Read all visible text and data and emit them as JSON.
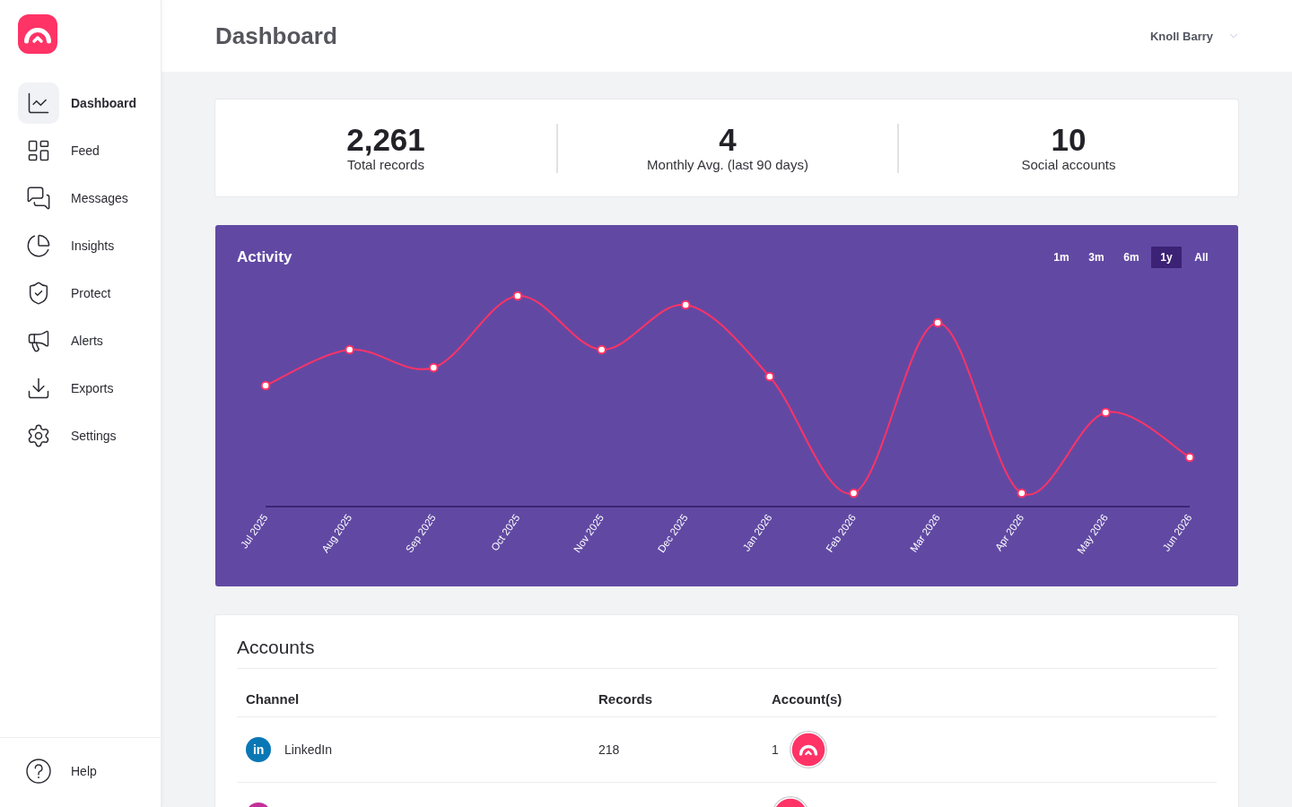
{
  "sidebar": {
    "items": [
      {
        "label": "Dashboard",
        "selected": true
      },
      {
        "label": "Feed",
        "selected": false
      },
      {
        "label": "Messages",
        "selected": false
      },
      {
        "label": "Insights",
        "selected": false
      },
      {
        "label": "Protect",
        "selected": false
      },
      {
        "label": "Alerts",
        "selected": false
      },
      {
        "label": "Exports",
        "selected": false
      },
      {
        "label": "Settings",
        "selected": false
      }
    ],
    "footer_items": [
      {
        "label": "Help",
        "selected": false
      }
    ]
  },
  "header": {
    "title": "Dashboard",
    "user": "Knoll Barry"
  },
  "stats": [
    {
      "value": "2,261",
      "label": "Total records"
    },
    {
      "value": "4",
      "label": "Monthly Avg. (last 90 days)"
    },
    {
      "value": "10",
      "label": "Social accounts"
    }
  ],
  "activity": {
    "title": "Activity",
    "ranges": [
      {
        "label": "1m",
        "selected": false
      },
      {
        "label": "3m",
        "selected": false
      },
      {
        "label": "6m",
        "selected": false
      },
      {
        "label": "1y",
        "selected": true
      },
      {
        "label": "All",
        "selected": false
      }
    ],
    "month_labels": [
      "Jul 2025",
      "Aug 2025",
      "Sep 2025",
      "Oct 2025",
      "Nov 2025",
      "Dec 2025",
      "Jan 2026",
      "Feb 2026",
      "Mar 2026",
      "Apr 2026",
      "May 2026",
      "Jun 2026"
    ]
  },
  "accounts": {
    "title": "Accounts",
    "columns": [
      "Channel",
      "Records",
      "Account(s)"
    ],
    "rows": [
      {
        "logo_text": "in",
        "channel": "LinkedIn",
        "records": "218",
        "accounts": "1",
        "color": "#0a77b5"
      },
      {
        "color": "#c2309a"
      }
    ]
  }
}
